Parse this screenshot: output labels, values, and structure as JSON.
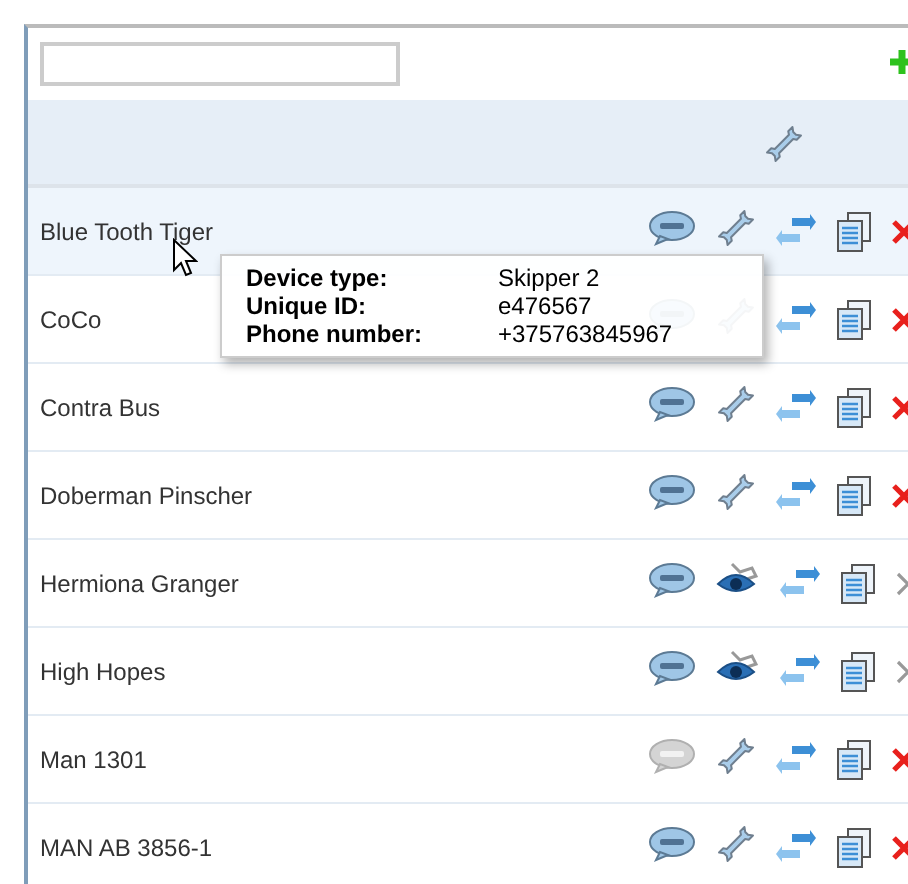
{
  "rows": [
    {
      "name": "Blue Tooth Tiger",
      "highlighted": true,
      "sms_enabled": true,
      "view_only": false,
      "delete_enabled": true
    },
    {
      "name": "CoCo",
      "highlighted": false,
      "sms_enabled": true,
      "view_only": false,
      "delete_enabled": true
    },
    {
      "name": "Contra Bus",
      "highlighted": false,
      "sms_enabled": true,
      "view_only": false,
      "delete_enabled": true
    },
    {
      "name": "Doberman Pinscher",
      "highlighted": false,
      "sms_enabled": true,
      "view_only": false,
      "delete_enabled": true
    },
    {
      "name": "Hermiona Granger",
      "highlighted": false,
      "sms_enabled": true,
      "view_only": true,
      "delete_enabled": false
    },
    {
      "name": "High Hopes",
      "highlighted": false,
      "sms_enabled": true,
      "view_only": true,
      "delete_enabled": false
    },
    {
      "name": "Man 1301",
      "highlighted": false,
      "sms_enabled": false,
      "view_only": false,
      "delete_enabled": true
    },
    {
      "name": "MAN AB 3856-1",
      "highlighted": false,
      "sms_enabled": true,
      "view_only": false,
      "delete_enabled": true
    }
  ],
  "tooltip": {
    "fields": [
      {
        "label": "Device type:",
        "value": "Skipper 2"
      },
      {
        "label": "Unique ID:",
        "value": "e476567"
      },
      {
        "label": "Phone number:",
        "value": "+375763845967"
      }
    ]
  }
}
